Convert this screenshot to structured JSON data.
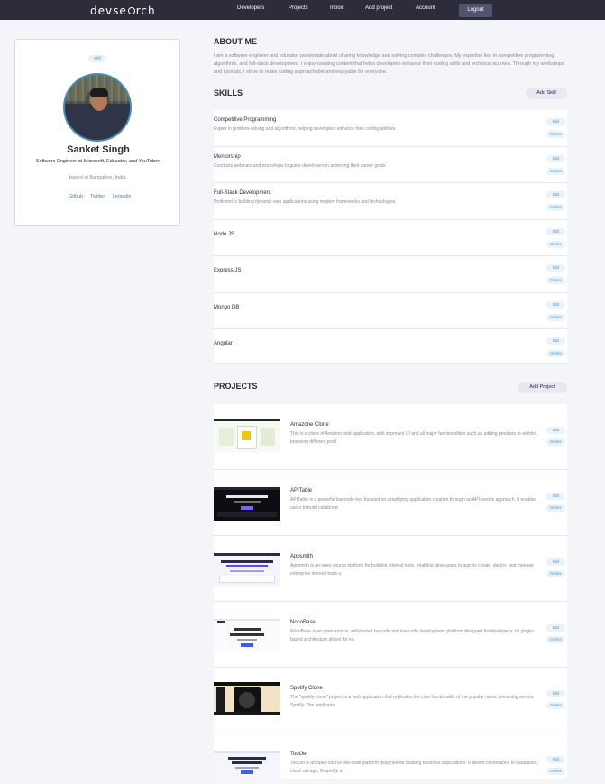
{
  "nav": {
    "logo_pre": "devse",
    "logo_post": "rch",
    "links": [
      "Developers",
      "Projects",
      "Inbox",
      "Add project",
      "Account"
    ],
    "logout": "Logout"
  },
  "profile": {
    "edit": "edit",
    "name": "Sanket Singh",
    "title": "Software Engineer at Microsoft, Educator, and YouTuber.",
    "location": "based in Bangalore, India.",
    "social": [
      "Github",
      "Twitter",
      "Linkedin"
    ]
  },
  "about": {
    "heading": "ABOUT ME",
    "text": "I am a software engineer and educator passionate about sharing knowledge and solving complex challenges. My expertise lies in competitive programming, algorithms, and full-stack development. I enjoy creating content that helps developers enhance their coding skills and technical acumen. Through my workshops and tutorials, I strive to make coding approachable and enjoyable for everyone."
  },
  "skills": {
    "heading": "SKILLS",
    "add_label": "Add Skill",
    "edit_label": "Edit",
    "delete_label": "Delete",
    "items": [
      {
        "name": "Competitive Programming",
        "desc": "Expert in problem-solving and algorithms, helping developers enhance their coding abilities."
      },
      {
        "name": "Mentorship",
        "desc": "Conducts webinars and workshops to guide developers in achieving their career goals."
      },
      {
        "name": "Full-Stack Development",
        "desc": "Proficient in building dynamic web applications using modern frameworks and technologies."
      },
      {
        "name": "Node JS",
        "desc": ""
      },
      {
        "name": "Express JS",
        "desc": ""
      },
      {
        "name": "Mongo DB",
        "desc": ""
      },
      {
        "name": "Angular",
        "desc": ""
      }
    ]
  },
  "projects": {
    "heading": "PROJECTS",
    "add_label": "Add Project",
    "edit_label": "Edit",
    "delete_label": "Delete",
    "items": [
      {
        "name": "Amazone Clone",
        "desc": "This is a clone of Amazon web application, with improved UI and all major functionalities such as adding products to wishlist, browsing different prod",
        "thumb": "light"
      },
      {
        "name": "APITable",
        "desc": "APITable is a powerful low-code tool focused on simplifying application creation through an API-centric approach. It enables users to build collaborat",
        "thumb": "dark"
      },
      {
        "name": "Appsmith",
        "desc": "Appsmith is an open-source platform for building internal tools, enabling developers to quickly create, deploy, and manage enterprise internal tools u",
        "thumb": "purple"
      },
      {
        "name": "NocoBase",
        "desc": "NocoBase is an open-source, self-hosted no-code and low-code development platform designed for developers. Its plugin-based architecture allows for ea",
        "thumb": "white"
      },
      {
        "name": "Spotify Clone",
        "desc": "The \"spotify-clone\" project is a web application that replicates the core functionality of the popular music streaming service Spotify. The applicatio",
        "thumb": "spotify"
      },
      {
        "name": "ToolJet",
        "desc": "ToolJet is an open-source low-code platform designed for building business applications. It allows connections to databases, cloud storage, GraphQL a",
        "thumb": "tooljet"
      }
    ]
  }
}
